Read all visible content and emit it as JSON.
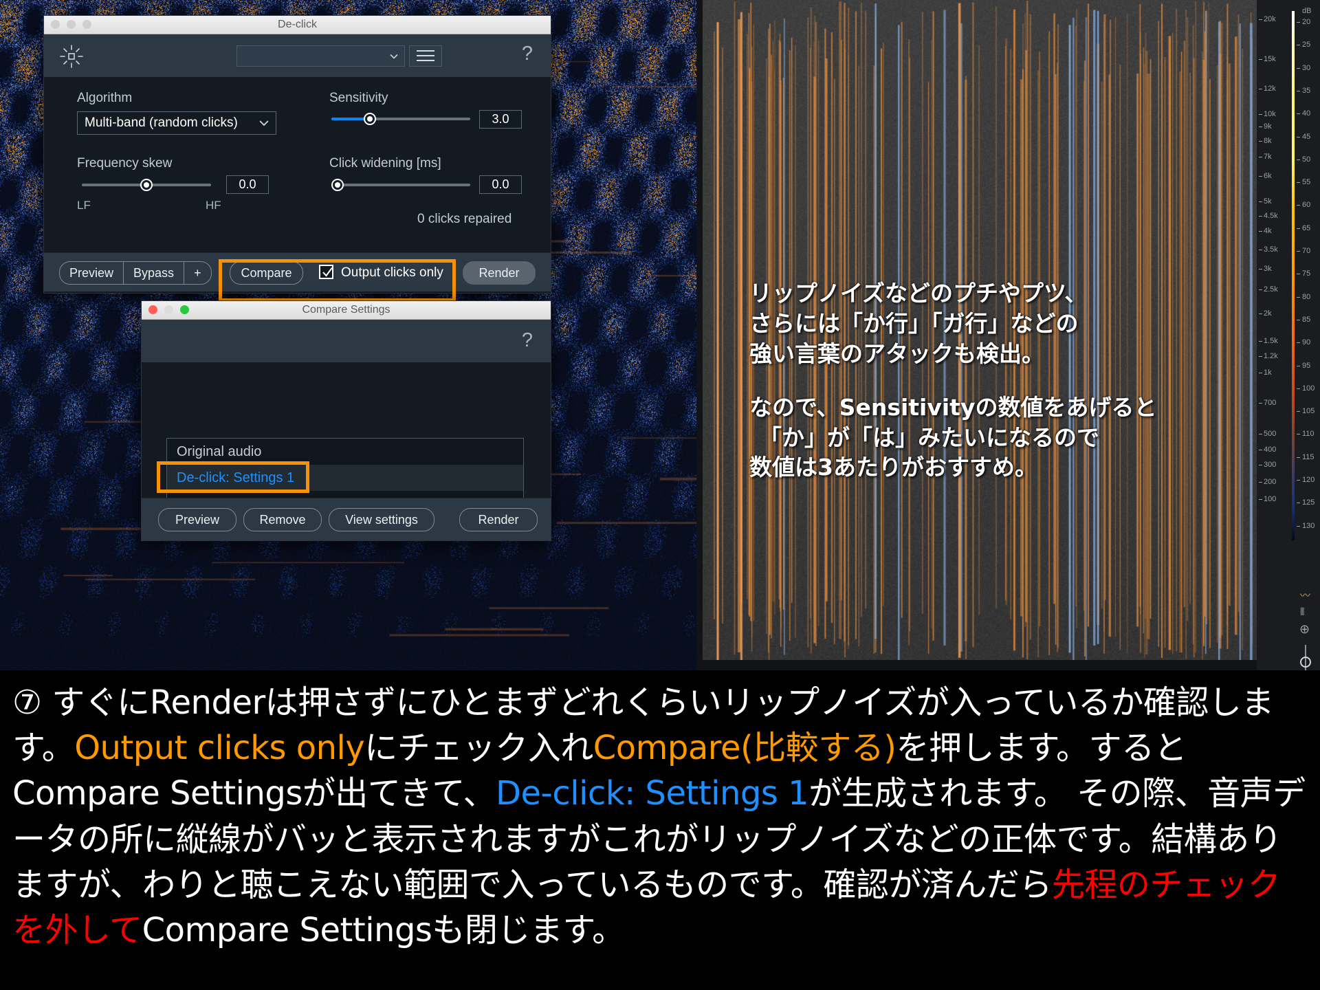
{
  "declick_window": {
    "title": "De-click",
    "traffic_lights": [
      "minimize-grey",
      "zoom-grey",
      "close-grey"
    ],
    "preset_value": "",
    "help_icon": "?",
    "menu_icon": "hamburger-icon",
    "logo_icon": "izotope-sun-icon",
    "controls": {
      "algorithm_label": "Algorithm",
      "algorithm_value": "Multi-band (random clicks)",
      "sensitivity_label": "Sensitivity",
      "sensitivity_value": "3.0",
      "frequency_skew_label": "Frequency skew",
      "frequency_skew_value": "0.0",
      "frequency_skew_min": "LF",
      "frequency_skew_max": "HF",
      "click_widening_label": "Click widening [ms]",
      "click_widening_value": "0.0",
      "clicks_repaired": "0 clicks repaired"
    },
    "footer": {
      "preview": "Preview",
      "bypass": "Bypass",
      "plus": "+",
      "compare": "Compare",
      "output_clicks_only": "Output clicks only",
      "output_clicks_only_checked": true,
      "render": "Render"
    }
  },
  "compare_window": {
    "title": "Compare Settings",
    "help_icon": "?",
    "list": [
      {
        "label": "Original audio",
        "selected": false
      },
      {
        "label": "De-click: Settings 1",
        "selected": true
      }
    ],
    "footer": {
      "preview": "Preview",
      "remove": "Remove",
      "view_settings": "View settings",
      "render": "Render"
    }
  },
  "spectrogram": {
    "freq_ticks": [
      "20k",
      "15k",
      "12k",
      "10k",
      "9k",
      "8k",
      "7k",
      "6k",
      "5k",
      "4.5k",
      "4k",
      "3.5k",
      "3k",
      "2.5k",
      "2k",
      "1.5k",
      "1.2k",
      "1k",
      "700",
      "500",
      "400",
      "300",
      "200",
      "100"
    ],
    "db_unit": "dB",
    "db_ticks": [
      "20",
      "25",
      "30",
      "35",
      "40",
      "45",
      "50",
      "55",
      "60",
      "65",
      "70",
      "75",
      "80",
      "85",
      "90",
      "95",
      "100",
      "105",
      "110",
      "115",
      "120",
      "125",
      "130"
    ],
    "tools": [
      "waveform-icon",
      "spectrum-icon",
      "zoom-in-icon",
      "zoom-slider"
    ]
  },
  "overlay_note": {
    "lines": [
      "リップノイズなどのプチやプツ、",
      "さらには「か行」「ガ行」などの",
      "強い言葉のアタックも検出。"
    ],
    "lines2": [
      "なので、Sensitivityの数値をあげると",
      "「か」が「は」みたいになるので",
      "数値は3あたりがおすすめ。"
    ]
  },
  "caption": {
    "segments": [
      {
        "text": "⑦ すぐにRenderは押さずにひとまずどれくらいリップノイズが入っているか確認します。",
        "color": "white"
      },
      {
        "text": "Output clicks only",
        "color": "orange"
      },
      {
        "text": "にチェック入れ",
        "color": "white"
      },
      {
        "text": "Compare(比較する)",
        "color": "orange"
      },
      {
        "text": "を押します。するとCompare Settingsが出てきて、",
        "color": "white"
      },
      {
        "text": "De-click: Settings 1",
        "color": "blue"
      },
      {
        "text": "が生成されます。 その際、音声データの所に縦線がバッと表示されますがこれがリップノイズなどの正体です。結構ありますが、わりと聴こえない範囲で入っているものです。確認が済んだら",
        "color": "white"
      },
      {
        "text": "先程のチェックを外して",
        "color": "red"
      },
      {
        "text": "Compare Settingsも閉じます。",
        "color": "white"
      }
    ]
  },
  "colors": {
    "accent_orange": "#f59208",
    "link_blue": "#1e90ff",
    "alert_red": "#ff0000",
    "slider_blue": "#0f86ef"
  }
}
